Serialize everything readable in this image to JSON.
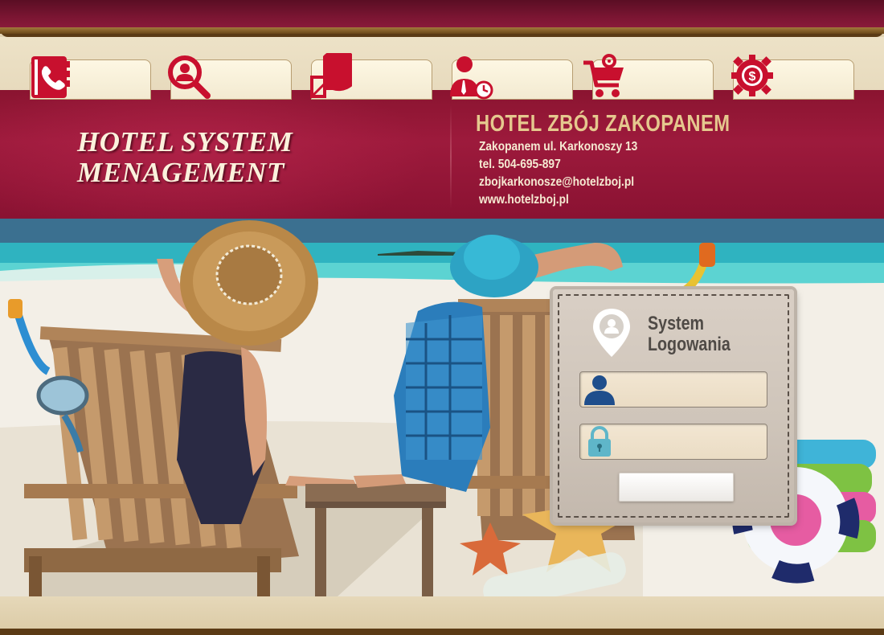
{
  "app": {
    "system_title_line1": "HOTEL SYSTEM",
    "system_title_line2": "MENAGEMENT"
  },
  "hotel": {
    "name": "HOTEL ZBÓJ ZAKOPANEM",
    "address": "Zakopanem ul. Karkonoszy 13",
    "phone": "tel. 504-695-897",
    "email": "zbojkarkonosze@hotelzboj.pl",
    "website": "www.hotelzboj.pl"
  },
  "nav": {
    "items": [
      {
        "icon": "phone-book-icon"
      },
      {
        "icon": "guest-search-icon"
      },
      {
        "icon": "report-chart-icon"
      },
      {
        "icon": "staff-schedule-icon"
      },
      {
        "icon": "cart-settings-icon"
      },
      {
        "icon": "finance-gear-icon"
      }
    ]
  },
  "login": {
    "title_line1": "System",
    "title_line2": "Logowania",
    "user_icon": "user-icon",
    "password_icon": "padlock-icon",
    "button_label": ""
  },
  "colors": {
    "crimson": "#9d1a3c",
    "gold": "#e5c88e",
    "nav_icon_red": "#c8102e",
    "beige": "#e2d3b3",
    "user_icon_blue": "#1f4e8c",
    "padlock_teal": "#5fb6c9"
  }
}
